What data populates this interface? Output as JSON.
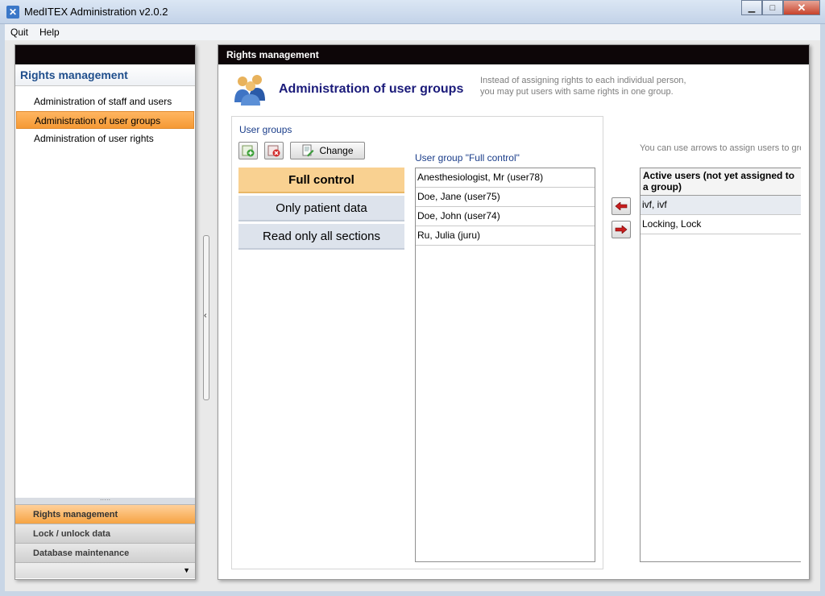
{
  "window": {
    "title": "MedITEX Administration v2.0.2"
  },
  "menu": {
    "items": [
      "Quit",
      "Help"
    ]
  },
  "sidebar": {
    "title": "Rights management",
    "items": [
      {
        "label": "Administration of staff and users"
      },
      {
        "label": "Administration of user groups"
      },
      {
        "label": "Administration of user rights"
      }
    ],
    "sections": [
      {
        "label": "Rights management"
      },
      {
        "label": "Lock / unlock data"
      },
      {
        "label": "Database maintenance"
      }
    ]
  },
  "panel": {
    "header": "Rights management",
    "title": "Administration of user groups",
    "description": "Instead of assigning rights to each individual person, you may put users with same rights in one group."
  },
  "groups": {
    "label": "User groups",
    "change_label": "Change",
    "items": [
      {
        "label": "Full control"
      },
      {
        "label": "Only patient data"
      },
      {
        "label": "Read only all sections"
      }
    ]
  },
  "members": {
    "label": "User group \"Full control\"",
    "rows": [
      "Anesthesiologist, Mr  (user78)",
      "Doe, Jane  (user75)",
      "Doe, John  (user74)",
      "Ru, Julia  (juru)"
    ]
  },
  "active": {
    "hint": "You can use arrows to assign users to group or drag & drop with a mouse inste",
    "header": "Active users (not yet assigned to a group)",
    "rows": [
      "ivf, ivf",
      "Locking, Lock"
    ]
  },
  "colors": {
    "accent": "#f59a35",
    "header_dark": "#0d0608",
    "title_blue": "#1b1b7a"
  }
}
